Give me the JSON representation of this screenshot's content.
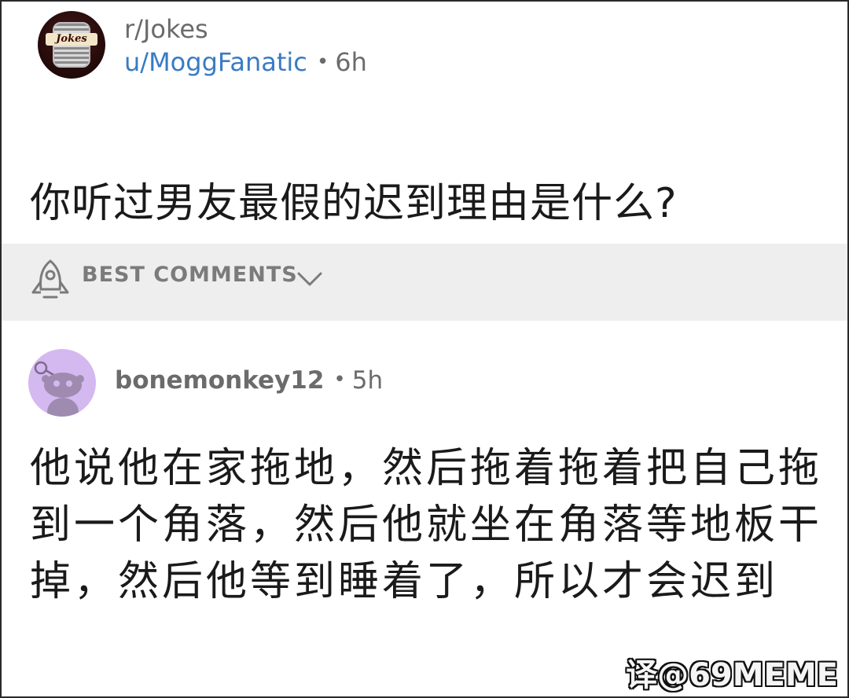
{
  "post": {
    "subreddit": "r/Jokes",
    "subreddit_logo_text": "Jokes",
    "author": "u/MoggFanatic",
    "separator": "•",
    "time": "6h",
    "title": "你听过男友最假的迟到理由是什么?"
  },
  "comments_bar": {
    "label": "BEST COMMENTS",
    "icon": "rocket-icon",
    "dropdown_icon": "chevron-down-icon"
  },
  "comment": {
    "author": "bonemonkey12",
    "separator": "•",
    "time": "5h",
    "body": "他说他在家拖地，然后拖着拖着把自己拖到一个角落，然后他就坐在角落等地板干掉，然后他等到睡着了，所以才会迟到",
    "avatar_icon": "snoo-avatar-icon",
    "avatar_color": "#d4b8f0"
  },
  "watermark": "译@69MEME"
}
